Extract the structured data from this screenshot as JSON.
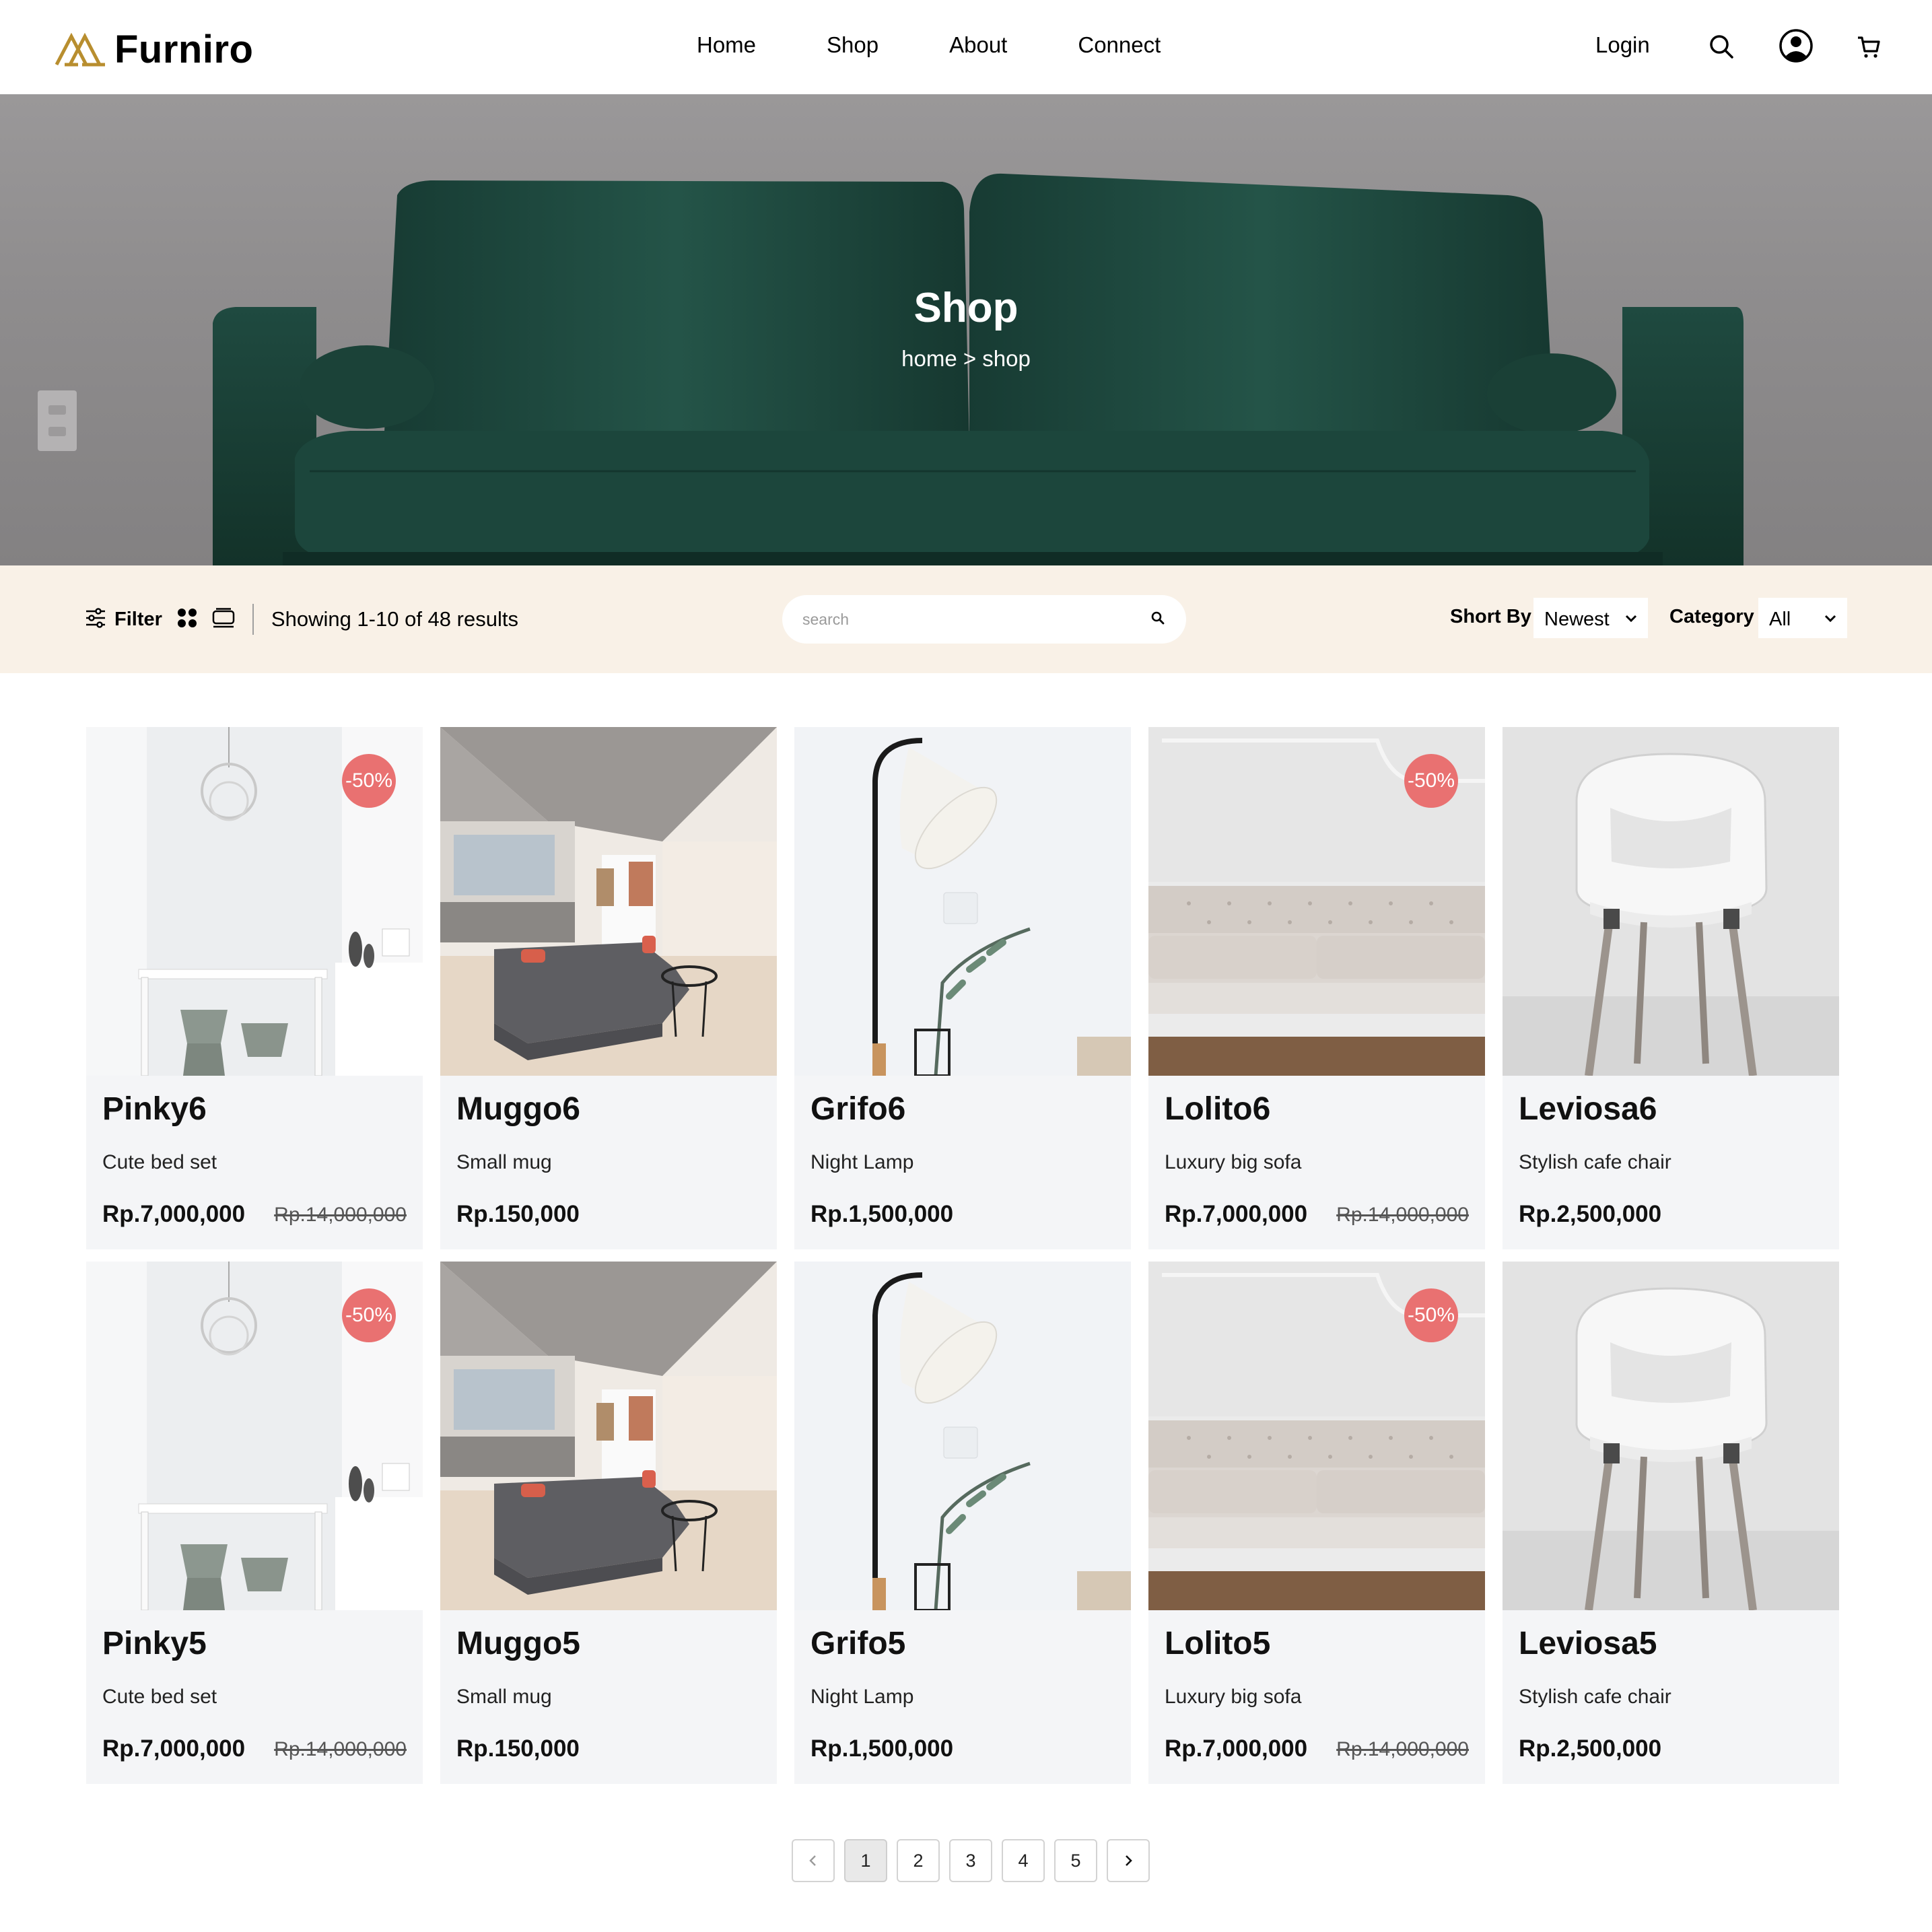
{
  "header": {
    "brand": "Furniro",
    "nav": [
      "Home",
      "Shop",
      "About",
      "Connect"
    ],
    "login": "Login",
    "icons": [
      "search-icon",
      "user-icon",
      "cart-icon"
    ]
  },
  "hero": {
    "title": "Shop",
    "breadcrumb": "home > shop"
  },
  "filterbar": {
    "filter_label": "Filter",
    "results_text": "Showing 1-10 of 48 results",
    "search_placeholder": "search",
    "sort_label": "Short By",
    "sort_value": "Newest",
    "category_label": "Category",
    "category_value": "All"
  },
  "colors": {
    "accent": "#b88e2f",
    "filter_bg": "#f9f1e7",
    "card_bg": "#f4f5f7",
    "badge": "#e97171"
  },
  "products": [
    {
      "name": "Pinky6",
      "desc": "Cute bed set",
      "price": "Rp.7,000,000",
      "old_price": "Rp.14,000,000",
      "badge": "-50%",
      "image": "dining-room"
    },
    {
      "name": "Muggo6",
      "desc": "Small mug",
      "price": "Rp.150,000",
      "old_price": "",
      "badge": "",
      "image": "living-room"
    },
    {
      "name": "Grifo6",
      "desc": "Night Lamp",
      "price": "Rp.1,500,000",
      "old_price": "",
      "badge": "",
      "image": "floor-lamp"
    },
    {
      "name": "Lolito6",
      "desc": "Luxury big sofa",
      "price": "Rp.7,000,000",
      "old_price": "Rp.14,000,000",
      "badge": "-50%",
      "image": "white-sofa"
    },
    {
      "name": "Leviosa6",
      "desc": "Stylish cafe chair",
      "price": "Rp.2,500,000",
      "old_price": "",
      "badge": "",
      "image": "white-chair"
    },
    {
      "name": "Pinky5",
      "desc": "Cute bed set",
      "price": "Rp.7,000,000",
      "old_price": "Rp.14,000,000",
      "badge": "-50%",
      "image": "dining-room"
    },
    {
      "name": "Muggo5",
      "desc": "Small mug",
      "price": "Rp.150,000",
      "old_price": "",
      "badge": "",
      "image": "living-room"
    },
    {
      "name": "Grifo5",
      "desc": "Night Lamp",
      "price": "Rp.1,500,000",
      "old_price": "",
      "badge": "",
      "image": "floor-lamp"
    },
    {
      "name": "Lolito5",
      "desc": "Luxury big sofa",
      "price": "Rp.7,000,000",
      "old_price": "Rp.14,000,000",
      "badge": "-50%",
      "image": "white-sofa"
    },
    {
      "name": "Leviosa5",
      "desc": "Stylish cafe chair",
      "price": "Rp.2,500,000",
      "old_price": "",
      "badge": "",
      "image": "white-chair"
    }
  ],
  "pagination": {
    "pages": [
      "1",
      "2",
      "3",
      "4",
      "5"
    ],
    "current": "1"
  }
}
